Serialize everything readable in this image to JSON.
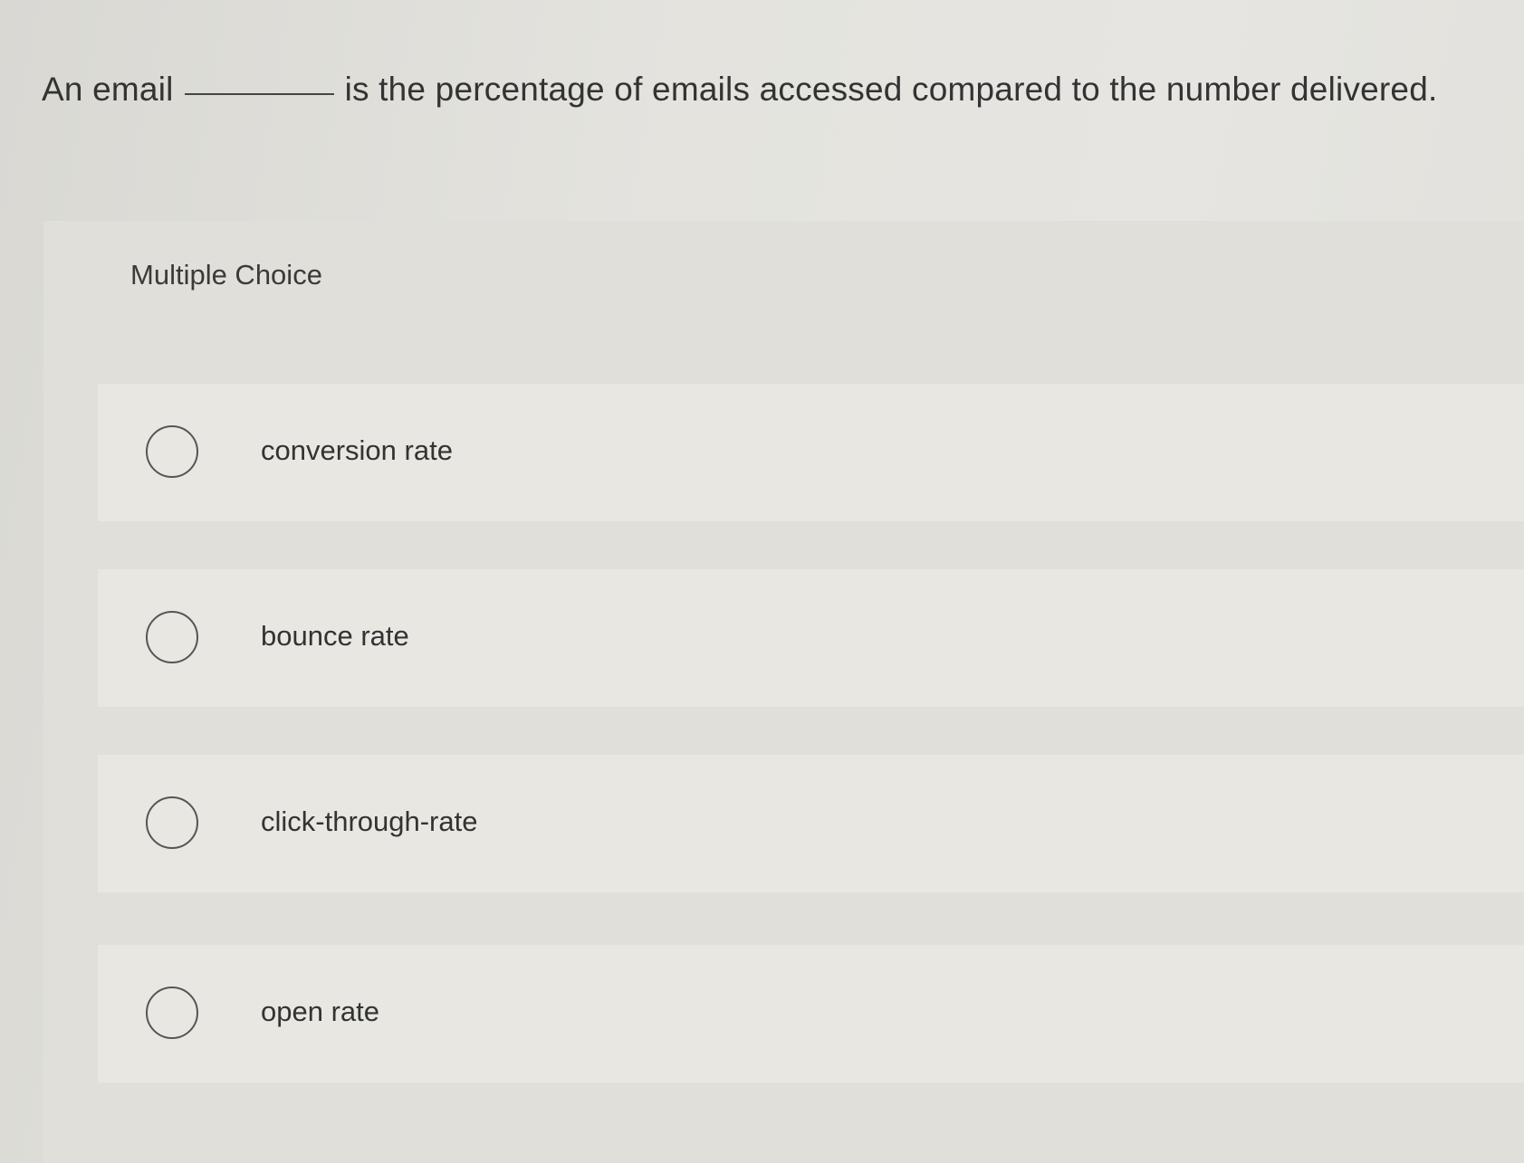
{
  "question": {
    "prefix": "An email",
    "suffix": "is the percentage of emails accessed compared to the number delivered."
  },
  "panel": {
    "label": "Multiple Choice"
  },
  "options": [
    {
      "label": "conversion rate"
    },
    {
      "label": "bounce rate"
    },
    {
      "label": "click-through-rate"
    },
    {
      "label": "open rate"
    }
  ]
}
